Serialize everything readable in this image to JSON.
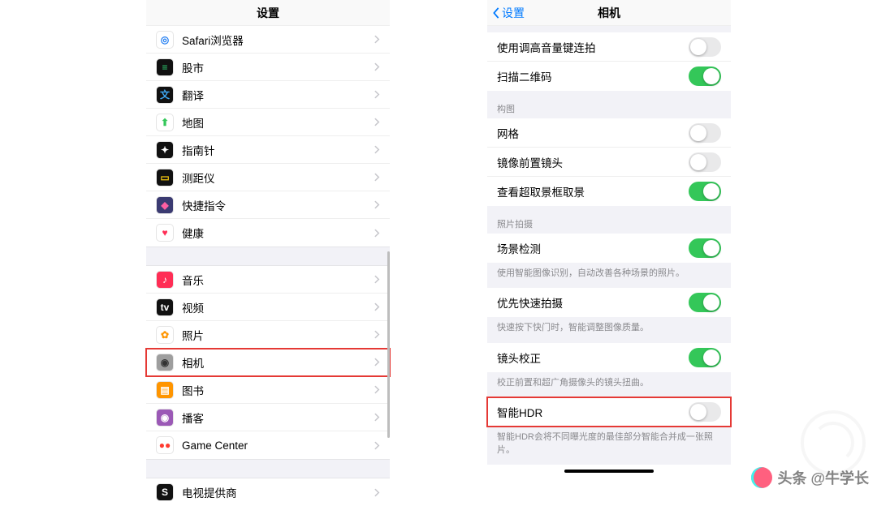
{
  "left": {
    "title": "设置",
    "group1": [
      {
        "key": "safari",
        "label": "Safari浏览器",
        "bg": "#fff",
        "fg": "#1f7cf1"
      },
      {
        "key": "stocks",
        "label": "股市",
        "bg": "#111",
        "fg": "#2ecc71"
      },
      {
        "key": "translate",
        "label": "翻译",
        "bg": "#111",
        "fg": "#3fa9f5"
      },
      {
        "key": "maps",
        "label": "地图",
        "bg": "#fff",
        "fg": "#34c759"
      },
      {
        "key": "compass",
        "label": "指南针",
        "bg": "#111",
        "fg": "#fff"
      },
      {
        "key": "measure",
        "label": "测距仪",
        "bg": "#111",
        "fg": "#f1c40f"
      },
      {
        "key": "shortcuts",
        "label": "快捷指令",
        "bg": "#3b3b72",
        "fg": "#ff5fa2"
      },
      {
        "key": "health",
        "label": "健康",
        "bg": "#fff",
        "fg": "#ff2d55"
      }
    ],
    "group2": [
      {
        "key": "music",
        "label": "音乐",
        "bg": "#ff2d55",
        "fg": "#fff"
      },
      {
        "key": "tv",
        "label": "视频",
        "bg": "#111",
        "fg": "#fff"
      },
      {
        "key": "photos",
        "label": "照片",
        "bg": "#fff",
        "fg": "#ff9500"
      },
      {
        "key": "camera",
        "label": "相机",
        "bg": "#9e9e9e",
        "fg": "#333"
      },
      {
        "key": "books",
        "label": "图书",
        "bg": "#ff9500",
        "fg": "#fff"
      },
      {
        "key": "podcasts",
        "label": "播客",
        "bg": "#9b59b6",
        "fg": "#fff"
      },
      {
        "key": "gamecenter",
        "label": "Game Center",
        "bg": "#fff",
        "fg": "#ff3b30"
      }
    ],
    "group3": [
      {
        "key": "tvprovider",
        "label": "电视提供商",
        "bg": "#111",
        "fg": "#fff"
      }
    ]
  },
  "right": {
    "back": "设置",
    "title": "相机",
    "sectionTop": [
      {
        "key": "volumeburst",
        "label": "使用调高音量键连拍",
        "on": false
      },
      {
        "key": "qrcode",
        "label": "扫描二维码",
        "on": true
      }
    ],
    "composition": {
      "header": "构图",
      "items": [
        {
          "key": "grid",
          "label": "网格",
          "on": false
        },
        {
          "key": "mirror",
          "label": "镜像前置镜头",
          "on": false
        },
        {
          "key": "outframe",
          "label": "查看超取景框取景",
          "on": true
        }
      ]
    },
    "capture": {
      "header": "照片拍摄",
      "sceneDetect": {
        "label": "场景检测",
        "on": true
      },
      "sceneFooter": "使用智能图像识别，自动改善各种场景的照片。",
      "fastShot": {
        "label": "优先快速拍摄",
        "on": true
      },
      "fastFooter": "快速按下快门时，智能调整图像质量。",
      "lensCorr": {
        "label": "镜头校正",
        "on": true
      },
      "lensFooter": "校正前置和超广角摄像头的镜头扭曲。",
      "hdr": {
        "label": "智能HDR",
        "on": false
      },
      "hdrFooter": "智能HDR会将不同曝光度的最佳部分智能合并成一张照片。"
    }
  },
  "watermark": "头条 @牛学长"
}
